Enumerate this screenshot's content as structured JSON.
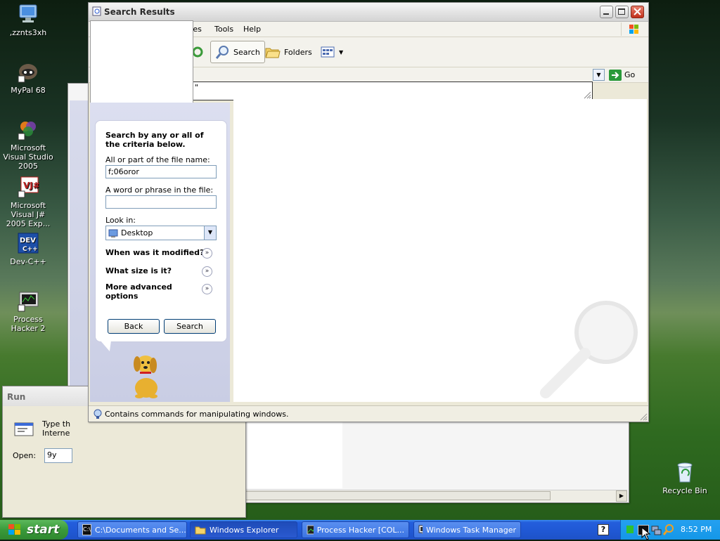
{
  "desktop_icons": [
    {
      "label": ",zznts3xh",
      "icon": "computer-icon"
    },
    {
      "label": "MyPal 68",
      "icon": "raccoon-icon"
    },
    {
      "label": "Microsoft Visual Studio 2005",
      "icon": "visual-studio-icon"
    },
    {
      "label": "Microsoft Visual J# 2005 Exp...",
      "icon": "vj-icon"
    },
    {
      "label": "Dev-C++",
      "icon": "dev-icon"
    },
    {
      "label": "Process Hacker 2",
      "icon": "process-hacker-icon"
    },
    {
      "label": "Recycle Bin",
      "icon": "recycle-bin-icon"
    }
  ],
  "search_window": {
    "title": "Search Results",
    "menu": [
      "tes",
      "Tools",
      "Help"
    ],
    "toolbar": {
      "search_label": "Search",
      "folders_label": "Folders"
    },
    "address_go": "Go",
    "address_fragment": "\"",
    "status_text": "Contains commands for manipulating windows."
  },
  "search_pane": {
    "heading": "Search by any or all of the criteria below.",
    "filename_label": "All or part of the file name:",
    "filename_value": "f;06oror",
    "phrase_label": "A word or phrase in the file:",
    "phrase_value": "",
    "lookin_label": "Look in:",
    "lookin_value": "Desktop",
    "option_modified": "When was it modified?",
    "option_size": "What size is it?",
    "option_advanced": "More advanced options",
    "back_button": "Back",
    "search_button": "Search"
  },
  "run_dialog": {
    "title": "Run",
    "description": "Type th\nInterne",
    "open_label": "Open:",
    "open_value": "9y"
  },
  "taskbar": {
    "start_label": "start",
    "tasks": [
      {
        "label": "C:\\Documents and Se...",
        "active": false
      },
      {
        "label": "Windows Explorer",
        "active": true
      },
      {
        "label": "Process Hacker [COL...",
        "active": false
      },
      {
        "label": "Windows Task Manager",
        "active": false
      }
    ],
    "clock": "8:52 PM",
    "help_icon": "?"
  },
  "colors": {
    "xp_blue": "#245edc",
    "start_green": "#3a9a3a",
    "pane_lavender": "#c9cde4"
  }
}
